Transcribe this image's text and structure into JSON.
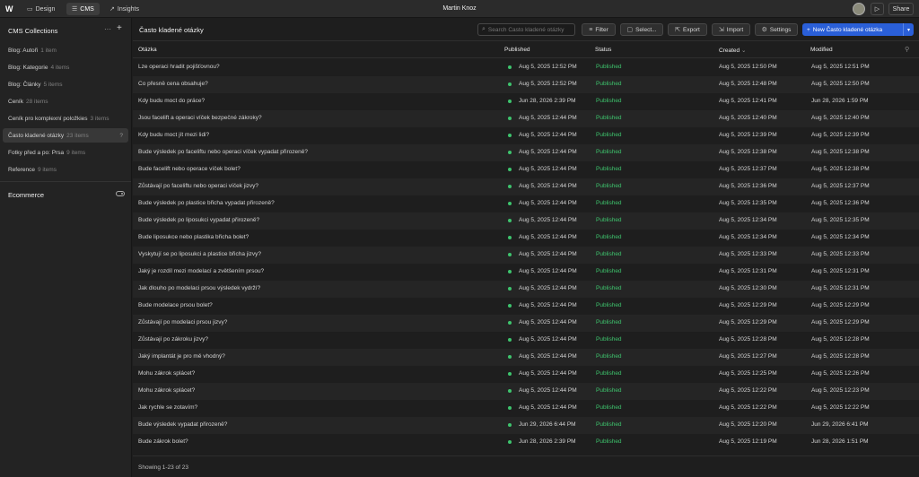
{
  "topbar": {
    "logo": "W",
    "nav": [
      {
        "label": "Design",
        "icon": "design-icon"
      },
      {
        "label": "CMS",
        "icon": "database-icon"
      },
      {
        "label": "Insights",
        "icon": "chart-icon"
      }
    ],
    "title": "Martin Knoz",
    "share_label": "Share"
  },
  "sidebar": {
    "title": "CMS Collections",
    "items": [
      {
        "label": "Blog: Autoři",
        "count": "1 item"
      },
      {
        "label": "Blog: Kategorie",
        "count": "4 items"
      },
      {
        "label": "Blog: Články",
        "count": "5 items"
      },
      {
        "label": "Ceník",
        "count": "28 items"
      },
      {
        "label": "Ceník pro komplexní položkies",
        "count": "3 items"
      },
      {
        "label": "Často kladené otázky",
        "count": "23 items"
      },
      {
        "label": "Fotky před a po: Prsa",
        "count": "9 items"
      },
      {
        "label": "Reference",
        "count": "9 items"
      }
    ],
    "active_marker": "?",
    "ecommerce_label": "Ecommerce"
  },
  "toolbar": {
    "collection_title": "Často kladené otázky",
    "search_placeholder": "Search Často kladené otázky",
    "filter_label": "Filter",
    "select_label": "Select...",
    "export_label": "Export",
    "import_label": "Import",
    "settings_label": "Settings",
    "new_label": "New Často kladené otázka"
  },
  "table": {
    "columns": {
      "question": "Otázka",
      "published": "Published",
      "status": "Status",
      "created": "Created",
      "modified": "Modified"
    },
    "rows": [
      {
        "q": "Lze operaci hradit pojišťovnou?",
        "pub": "Aug 5, 2025 12:52 PM",
        "status": "Published",
        "created": "Aug 5, 2025 12:50 PM",
        "modified": "Aug 5, 2025 12:51 PM"
      },
      {
        "q": "Co přesně cena obsahuje?",
        "pub": "Aug 5, 2025 12:52 PM",
        "status": "Published",
        "created": "Aug 5, 2025 12:48 PM",
        "modified": "Aug 5, 2025 12:50 PM"
      },
      {
        "q": "Kdy budu moct do práce?",
        "pub": "Jun 28, 2026 2:39 PM",
        "status": "Published",
        "created": "Aug 5, 2025 12:41 PM",
        "modified": "Jun 28, 2026 1:59 PM"
      },
      {
        "q": "Jsou facelift a operaci víček bezpečné zákroky?",
        "pub": "Aug 5, 2025 12:44 PM",
        "status": "Published",
        "created": "Aug 5, 2025 12:40 PM",
        "modified": "Aug 5, 2025 12:40 PM"
      },
      {
        "q": "Kdy budu moct jít mezi lidi?",
        "pub": "Aug 5, 2025 12:44 PM",
        "status": "Published",
        "created": "Aug 5, 2025 12:39 PM",
        "modified": "Aug 5, 2025 12:39 PM"
      },
      {
        "q": "Bude výsledek po faceliftu nebo operaci víček vypadat přirozeně?",
        "pub": "Aug 5, 2025 12:44 PM",
        "status": "Published",
        "created": "Aug 5, 2025 12:38 PM",
        "modified": "Aug 5, 2025 12:38 PM"
      },
      {
        "q": "Bude facelift nebo operace víček bolet?",
        "pub": "Aug 5, 2025 12:44 PM",
        "status": "Published",
        "created": "Aug 5, 2025 12:37 PM",
        "modified": "Aug 5, 2025 12:38 PM"
      },
      {
        "q": "Zůstávají po faceliftu nebo operaci víček jizvy?",
        "pub": "Aug 5, 2025 12:44 PM",
        "status": "Published",
        "created": "Aug 5, 2025 12:36 PM",
        "modified": "Aug 5, 2025 12:37 PM"
      },
      {
        "q": "Bude výsledek po plastice břicha vypadat přirozeně?",
        "pub": "Aug 5, 2025 12:44 PM",
        "status": "Published",
        "created": "Aug 5, 2025 12:35 PM",
        "modified": "Aug 5, 2025 12:36 PM"
      },
      {
        "q": "Bude výsledek po liposukci vypadat přirozeně?",
        "pub": "Aug 5, 2025 12:44 PM",
        "status": "Published",
        "created": "Aug 5, 2025 12:34 PM",
        "modified": "Aug 5, 2025 12:35 PM"
      },
      {
        "q": "Bude liposukce nebo plastika břicha bolet?",
        "pub": "Aug 5, 2025 12:44 PM",
        "status": "Published",
        "created": "Aug 5, 2025 12:34 PM",
        "modified": "Aug 5, 2025 12:34 PM"
      },
      {
        "q": "Vyskytují se po liposukci a plastice břicha jizvy?",
        "pub": "Aug 5, 2025 12:44 PM",
        "status": "Published",
        "created": "Aug 5, 2025 12:33 PM",
        "modified": "Aug 5, 2025 12:33 PM"
      },
      {
        "q": "Jaký je rozdíl mezi modelací a zvětšením prsou?",
        "pub": "Aug 5, 2025 12:44 PM",
        "status": "Published",
        "created": "Aug 5, 2025 12:31 PM",
        "modified": "Aug 5, 2025 12:31 PM"
      },
      {
        "q": "Jak dlouho po modelaci prsou výsledek vydrží?",
        "pub": "Aug 5, 2025 12:44 PM",
        "status": "Published",
        "created": "Aug 5, 2025 12:30 PM",
        "modified": "Aug 5, 2025 12:31 PM"
      },
      {
        "q": "Bude modelace prsou bolet?",
        "pub": "Aug 5, 2025 12:44 PM",
        "status": "Published",
        "created": "Aug 5, 2025 12:29 PM",
        "modified": "Aug 5, 2025 12:29 PM"
      },
      {
        "q": "Zůstávají po modelaci prsou jizvy?",
        "pub": "Aug 5, 2025 12:44 PM",
        "status": "Published",
        "created": "Aug 5, 2025 12:29 PM",
        "modified": "Aug 5, 2025 12:29 PM"
      },
      {
        "q": "Zůstávají po zákroku jizvy?",
        "pub": "Aug 5, 2025 12:44 PM",
        "status": "Published",
        "created": "Aug 5, 2025 12:28 PM",
        "modified": "Aug 5, 2025 12:28 PM"
      },
      {
        "q": "Jaký implantát je pro mě vhodný?",
        "pub": "Aug 5, 2025 12:44 PM",
        "status": "Published",
        "created": "Aug 5, 2025 12:27 PM",
        "modified": "Aug 5, 2025 12:28 PM"
      },
      {
        "q": "Mohu zákrok splácet?",
        "pub": "Aug 5, 2025 12:44 PM",
        "status": "Published",
        "created": "Aug 5, 2025 12:25 PM",
        "modified": "Aug 5, 2025 12:26 PM"
      },
      {
        "q": "Mohu zákrok splácet?",
        "pub": "Aug 5, 2025 12:44 PM",
        "status": "Published",
        "created": "Aug 5, 2025 12:22 PM",
        "modified": "Aug 5, 2025 12:23 PM"
      },
      {
        "q": "Jak rychle se zotavím?",
        "pub": "Aug 5, 2025 12:44 PM",
        "status": "Published",
        "created": "Aug 5, 2025 12:22 PM",
        "modified": "Aug 5, 2025 12:22 PM"
      },
      {
        "q": "Bude výsledek vypadat přirozeně?",
        "pub": "Jun 29, 2026 6:44 PM",
        "status": "Published",
        "created": "Aug 5, 2025 12:20 PM",
        "modified": "Jun 29, 2026 6:41 PM"
      },
      {
        "q": "Bude zákrok bolet?",
        "pub": "Jun 28, 2026 2:39 PM",
        "status": "Published",
        "created": "Aug 5, 2025 12:19 PM",
        "modified": "Jun 28, 2026 1:51 PM"
      }
    ]
  },
  "footer": {
    "text": "Showing 1-23 of 23"
  },
  "colors": {
    "accent": "#2a5fd8",
    "published": "#3ec46d"
  }
}
